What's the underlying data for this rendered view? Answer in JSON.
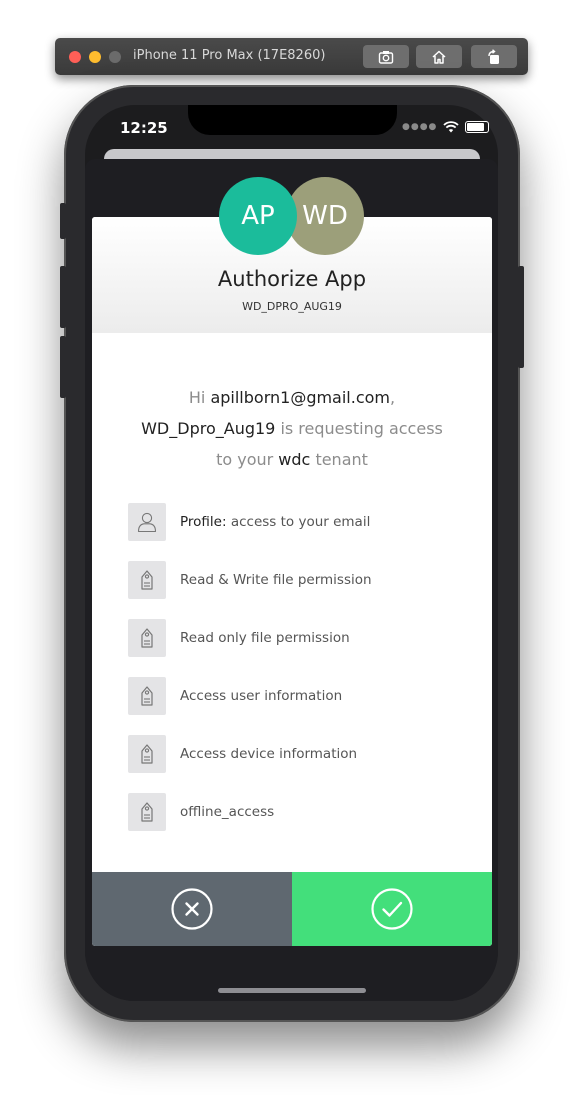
{
  "simulator": {
    "title": "iPhone 11 Pro Max (17E8260)",
    "buttons": [
      "screenshot-icon",
      "home-icon",
      "rotate-icon"
    ]
  },
  "status_bar": {
    "time": "12:25",
    "icons": [
      "signal-dots-icon",
      "wifi-icon",
      "battery-icon"
    ]
  },
  "header": {
    "avatars": [
      {
        "initials": "AP",
        "color": "#1bbc9b"
      },
      {
        "initials": "WD",
        "color": "#9c9f7a"
      }
    ],
    "title": "Authorize App",
    "client_id": "WD_DPRO_AUG19"
  },
  "message": {
    "greeting": "Hi",
    "email": "apillborn1@gmail.com",
    "comma": ",",
    "app_name": "WD_Dpro_Aug19",
    "requesting": "is requesting access",
    "to_your": "to your",
    "tenant_name": "wdc",
    "tenant": "tenant"
  },
  "permissions": [
    {
      "icon": "user-icon",
      "bold": "Profile:",
      "text": "access to your email"
    },
    {
      "icon": "tag-icon",
      "bold": "",
      "text": "Read & Write file permission"
    },
    {
      "icon": "tag-icon",
      "bold": "",
      "text": "Read only file permission"
    },
    {
      "icon": "tag-icon",
      "bold": "",
      "text": "Access user information"
    },
    {
      "icon": "tag-icon",
      "bold": "",
      "text": "Access device information"
    },
    {
      "icon": "tag-icon",
      "bold": "",
      "text": "offline_access"
    }
  ],
  "actions": {
    "deny_icon": "close-circle-icon",
    "allow_icon": "check-circle-icon",
    "deny_color": "#5f6870",
    "allow_color": "#43df7b"
  }
}
